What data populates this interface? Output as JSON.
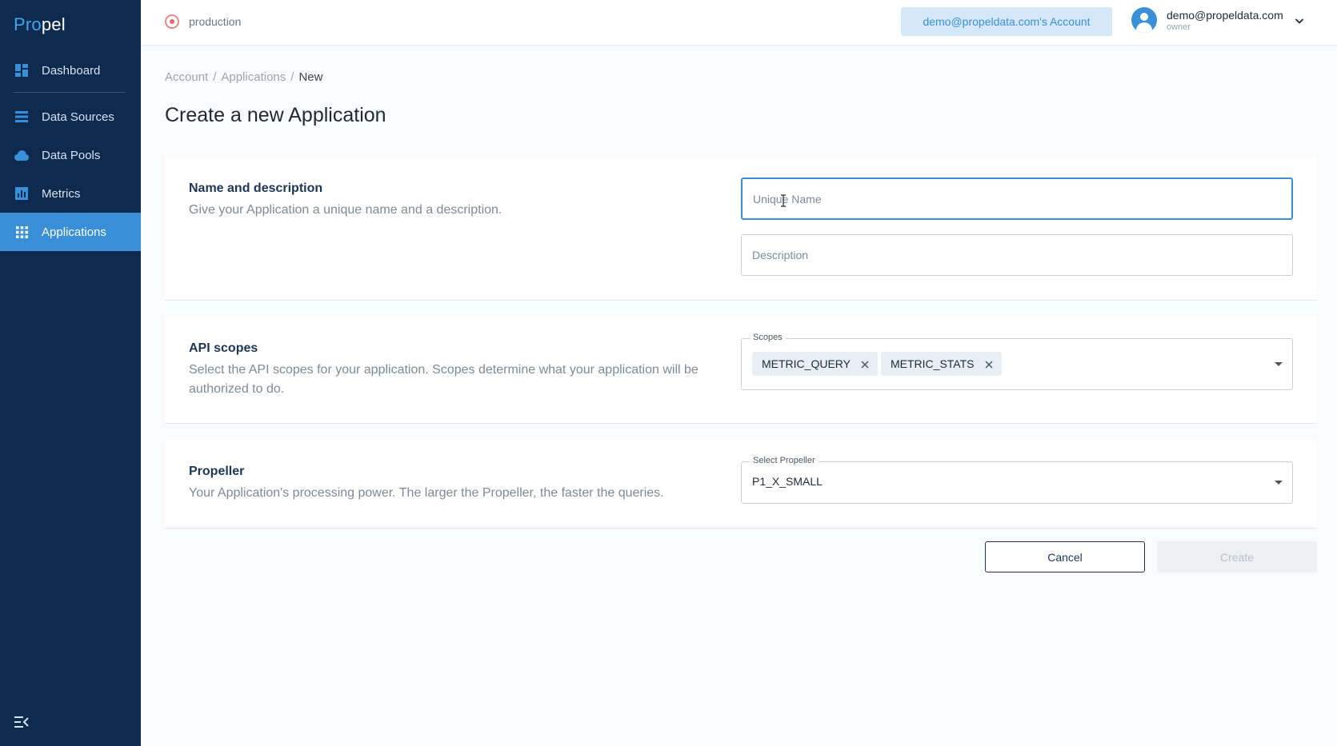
{
  "sidebar": {
    "logo_a": "Pro",
    "logo_b": "pel",
    "items": [
      {
        "label": "Dashboard",
        "icon": "dashboard-icon"
      },
      {
        "label": "Data Sources",
        "icon": "list-icon"
      },
      {
        "label": "Data Pools",
        "icon": "cloud-icon"
      },
      {
        "label": "Metrics",
        "icon": "bar-chart-icon"
      },
      {
        "label": "Applications",
        "icon": "apps-grid-icon",
        "active": true
      }
    ]
  },
  "topbar": {
    "environment": "production",
    "account_button": "demo@propeldata.com's Account",
    "user_email": "demo@propeldata.com",
    "user_role": "owner"
  },
  "breadcrumb": {
    "items": [
      "Account",
      "Applications",
      "New"
    ],
    "separator": "/"
  },
  "page_title": "Create a new Application",
  "sections": {
    "name": {
      "title": "Name and description",
      "description": "Give your Application a unique name and a description.",
      "name_placeholder": "Unique Name",
      "description_placeholder": "Description"
    },
    "scopes": {
      "title": "API scopes",
      "description": "Select the API scopes for your application. Scopes determine what your application will be authorized to do.",
      "field_label": "Scopes",
      "chips": [
        "METRIC_QUERY",
        "METRIC_STATS"
      ]
    },
    "propeller": {
      "title": "Propeller",
      "description": "Your Application's processing power. The larger the Propeller, the faster the queries.",
      "field_label": "Select Propeller",
      "value": "P1_X_SMALL"
    }
  },
  "actions": {
    "cancel": "Cancel",
    "create": "Create"
  },
  "colors": {
    "sidebar_bg": "#0e2a4f",
    "accent": "#3a8fd9",
    "active_nav": "#3a8fd9"
  }
}
